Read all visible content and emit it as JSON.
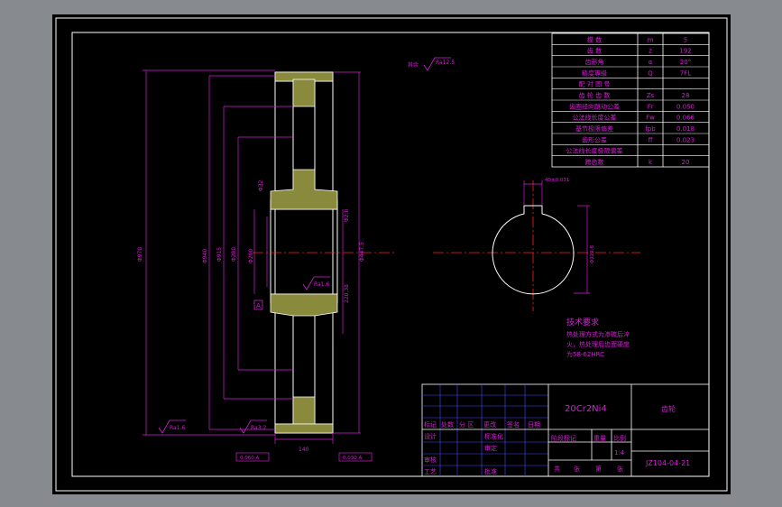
{
  "colors": {
    "bg_outer": "#878b90",
    "sheet": "#000000",
    "frame": "#ffffff",
    "dim": "#d41fd4",
    "center": "#ff2020",
    "table": "#4b4bff",
    "text": "#d41fd4"
  },
  "params": {
    "rows": [
      {
        "label": "模 数",
        "sym": "m",
        "value": "5"
      },
      {
        "label": "齿 数",
        "sym": "z",
        "value": "192"
      },
      {
        "label": "齿形角",
        "sym": "α",
        "value": "20°"
      },
      {
        "label": "精度等级",
        "sym": "Q",
        "value": "7FL"
      },
      {
        "label": "配 对  图 号",
        "sym": "",
        "value": ""
      },
      {
        "label": "齿 轮   齿 数",
        "sym": "Zs",
        "value": "28"
      },
      {
        "label": "齿圈径向跳动公差",
        "sym": "Fr",
        "value": "0.050"
      },
      {
        "label": "公法线长度公差",
        "sym": "Fw",
        "value": "0.066"
      },
      {
        "label": "基节极限偏差",
        "sym": "fpb",
        "value": "0.018"
      },
      {
        "label": "齿形公差",
        "sym": "ff",
        "value": "0.023"
      },
      {
        "label": "公法线长度极限偏差",
        "sym": "",
        "value": ""
      },
      {
        "label": "跨齿数",
        "sym": "k",
        "value": "20"
      }
    ]
  },
  "notes": {
    "title": "技术要求",
    "lines": [
      "热处理方式为渗碳后淬",
      "火，热处理后齿面硬度",
      "为58-62HRC"
    ]
  },
  "titleblock": {
    "material": "20Cr2Ni4",
    "part_name": "齿轮",
    "drawing_no": "JZ104-04-21",
    "scale_value": "1:4",
    "header_cells": [
      "标记",
      "处数",
      "分 区",
      "更改",
      "签名",
      "日期"
    ],
    "left_labels": [
      "设计",
      "审核",
      "工艺"
    ],
    "mid_labels": [
      "标准化",
      "审定",
      "批准"
    ],
    "stage_labels": [
      "阶段标记",
      "重量",
      "比例"
    ],
    "sheet_labels": [
      "共",
      "张",
      "第",
      "张"
    ]
  },
  "annotations": {
    "rest": "其余",
    "ra_other": "Ra12.5",
    "ra_face": "Ra1.6",
    "ra_hub": "Ra3.2",
    "ra_bore": "Ra1.6",
    "datum": "A",
    "dim_overall": "Φ970",
    "dim_tip": "Φ940",
    "dim_root": "Φ915",
    "dim_hub_outer": "Φ280",
    "dim_bore": "Φ200",
    "dim_keyway": "220.38",
    "dim_face_width": "140",
    "dim_right": "Φ447.5",
    "dim_rib": "Φ32",
    "dim_hub_width": "Φ2.0",
    "dim_key_width": "40±0.031",
    "dim_key_depth": "Φ222.8",
    "tol_left": "0.060 A",
    "tol_right": "0.030 A"
  }
}
